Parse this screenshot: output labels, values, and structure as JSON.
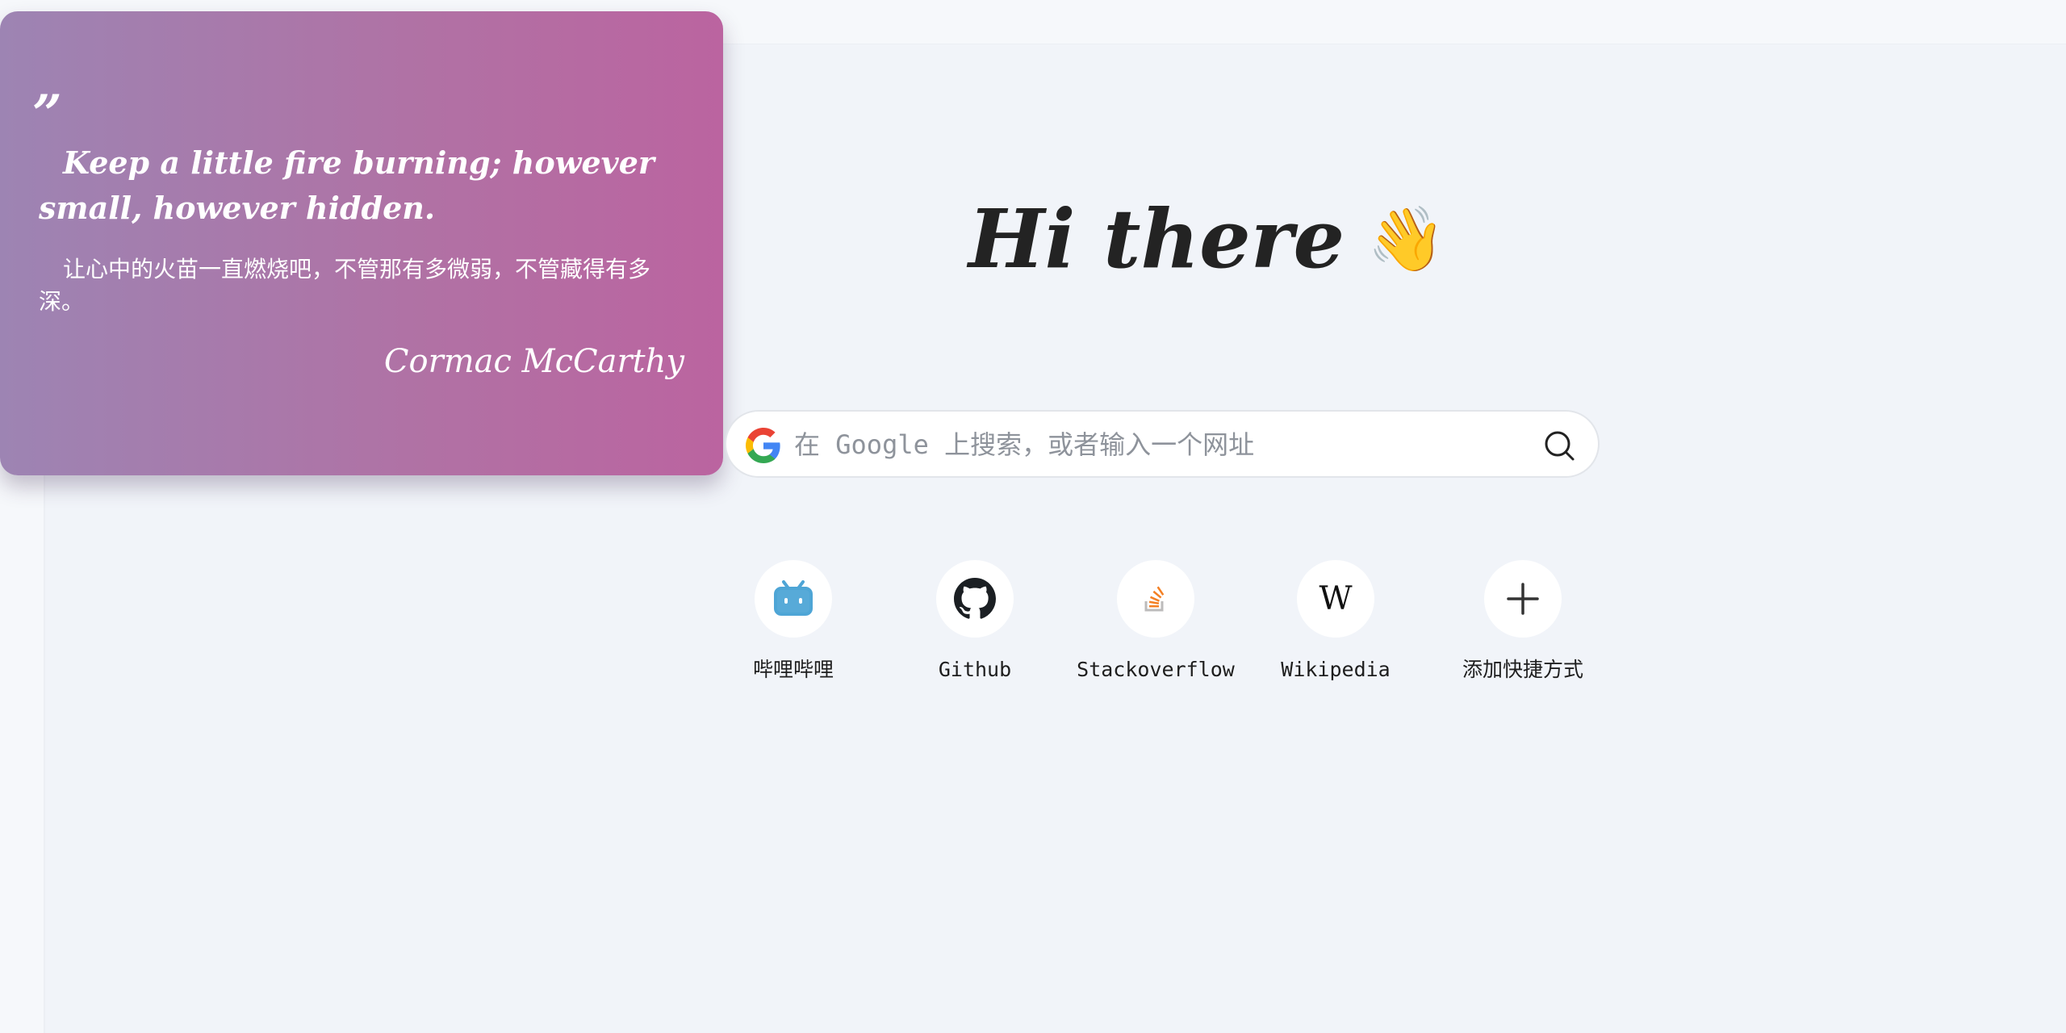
{
  "quote": {
    "mark": "”",
    "english": "Keep a little fire burning; however small, however hidden.",
    "chinese": "让心中的火苗一直燃烧吧，不管那有多微弱，不管藏得有多深。",
    "author": "Cormac McCarthy"
  },
  "greeting": {
    "text": "Hi there",
    "emoji": "👋"
  },
  "search": {
    "placeholder": "在 Google 上搜索，或者输入一个网址",
    "engine_icon": "google-icon",
    "button_icon": "search-icon"
  },
  "shortcuts": [
    {
      "label": "哔哩哔哩",
      "icon": "bilibili-icon",
      "color": "#4ea5d6"
    },
    {
      "label": "Github",
      "icon": "github-icon",
      "color": "#1b1f23"
    },
    {
      "label": "Stackoverflow",
      "icon": "stackoverflow-icon",
      "color": "#f48024"
    },
    {
      "label": "Wikipedia",
      "icon": "wikipedia-icon",
      "color": "#111111"
    },
    {
      "label": "添加快捷方式",
      "icon": "plus-icon",
      "color": "#333333"
    }
  ],
  "colors": {
    "background": "#f1f4f9",
    "card_gradient_start": "#9d84b3",
    "card_gradient_end": "#bb64a0",
    "text_dark": "#232323"
  }
}
